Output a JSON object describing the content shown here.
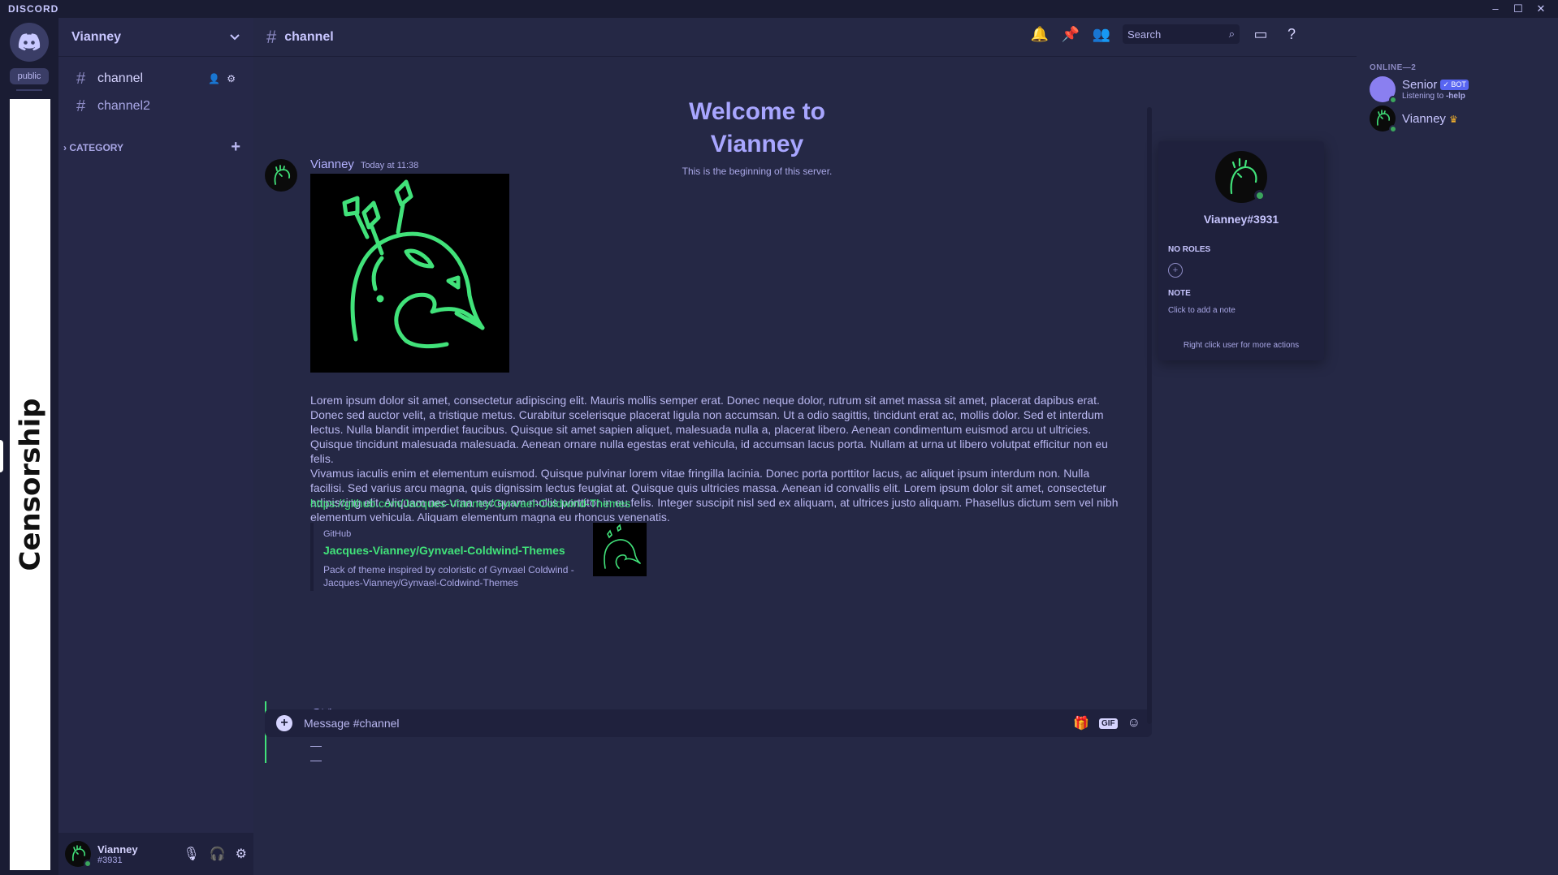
{
  "app": {
    "brand": "DISCORD"
  },
  "guilds": {
    "public_label": "public",
    "banner_text": "Censorship"
  },
  "server": {
    "name": "Vianney"
  },
  "channels": [
    {
      "name": "channel"
    },
    {
      "name": "channel2"
    }
  ],
  "category": {
    "label": "CATEGORY"
  },
  "header": {
    "channel": "channel",
    "search_placeholder": "Search"
  },
  "welcome": {
    "title": "Welcome to Vianney",
    "subtitle": "This is the beginning of this server."
  },
  "message": {
    "author": "Vianney",
    "timestamp": "Today at 11:38",
    "para1": "Lorem ipsum dolor sit amet, consectetur adipiscing elit. Mauris mollis semper erat. Donec neque dolor, rutrum sit amet massa sit amet, placerat dapibus erat. Donec sed auctor velit, a tristique metus. Curabitur scelerisque placerat ligula non accumsan. Ut a odio sagittis, tincidunt erat ac, mollis dolor. Sed et interdum lectus. Nulla blandit imperdiet faucibus. Quisque sit amet sapien aliquet, malesuada nulla a, placerat libero. Aenean condimentum euismod arcu ut ultricies. Quisque tincidunt malesuada malesuada. Aenean ornare nulla egestas erat vehicula, id accumsan lacus porta. Nullam at urna ut libero volutpat efficitur non eu felis.",
    "para2": "Vivamus iaculis enim et elementum euismod. Quisque pulvinar lorem vitae fringilla lacinia. Donec porta porttitor lacus, ac aliquet ipsum interdum non. Nulla facilisi. Sed varius arcu magna, quis dignissim lectus feugiat at. Quisque quis ultricies massa. Aenean id convallis elit. Lorem ipsum dolor sit amet, consectetur adipiscing elit. Aliquam nec urna nec quam mollis porttitor in eu felis. Integer suscipit nisl sed ex aliquam, at ultrices justo aliquam. Phasellus dictum sem vel nibh elementum vehicula. Aliquam elementum magna eu rhoncus venenatis.",
    "link": "https://github.com/Jacques-Vianney/Gynvael-Coldwind-Themes",
    "embed": {
      "provider": "GitHub",
      "title": "Jacques-Vianney/Gynvael-Coldwind-Themes",
      "description": "Pack of theme inspired by coloristic of Gynvael Coldwind - Jacques-Vianney/Gynvael-Coldwind-Themes"
    },
    "mention": "@Vianney",
    "dashes": [
      "—",
      "—",
      "—"
    ]
  },
  "composer": {
    "placeholder": "Message #channel",
    "gif_label": "GIF"
  },
  "popout": {
    "name": "Vianney#3931",
    "roles_label": "NO ROLES",
    "note_label": "NOTE",
    "note_placeholder": "Click to add a note",
    "hint": "Right click user for more actions"
  },
  "members": {
    "group_label": "ONLINE—2",
    "list": [
      {
        "name": "Senior",
        "badge": "✓ BOT",
        "status_prefix": "Listening to ",
        "status_bold": "-help"
      },
      {
        "name": "Vianney"
      }
    ]
  },
  "user": {
    "name": "Vianney",
    "tag": "#3931"
  },
  "colors": {
    "accent_green": "#41e27a",
    "online": "#3ba55d",
    "bg": "#252845",
    "sidebar": "#262848"
  }
}
